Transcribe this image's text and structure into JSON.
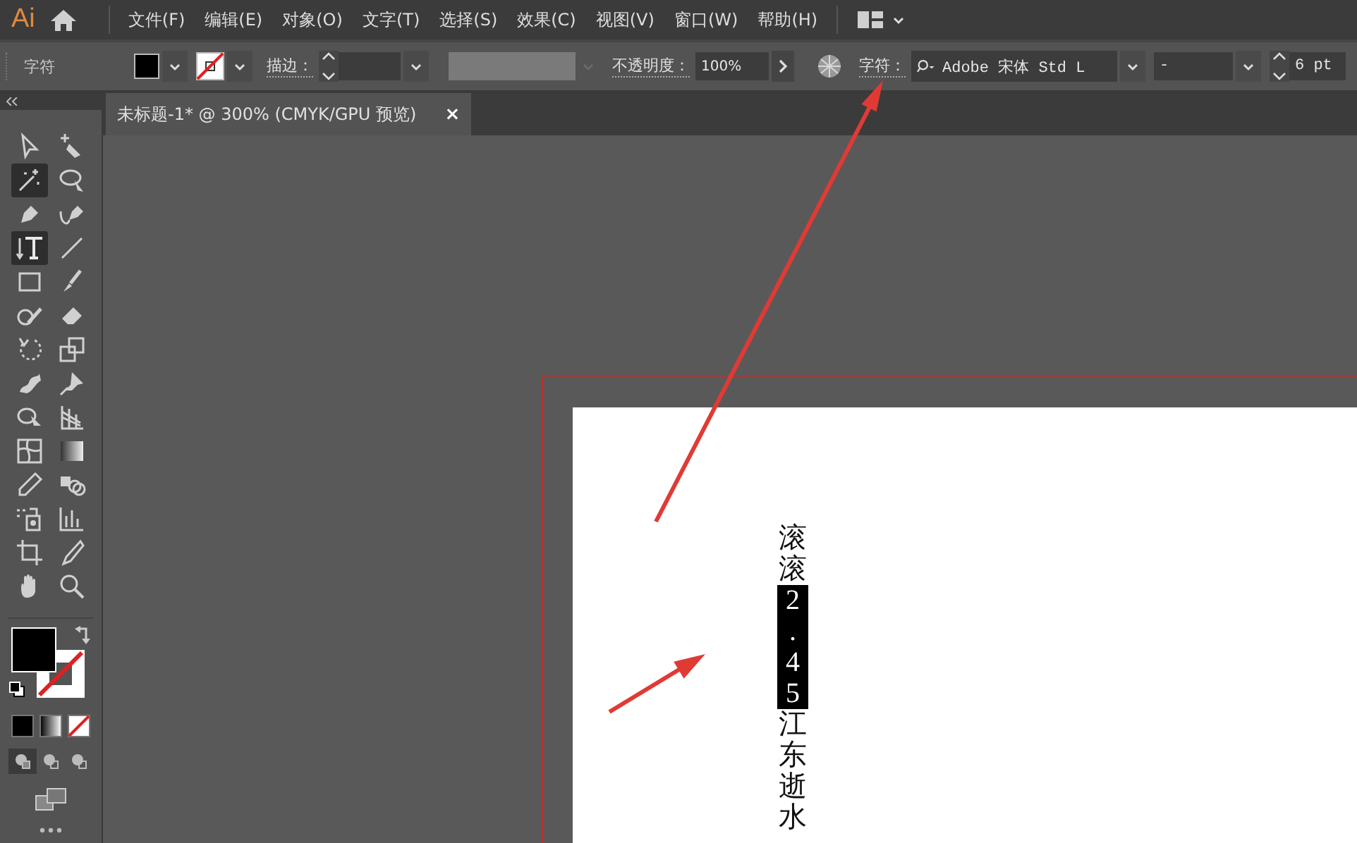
{
  "app": {
    "logo": "Ai"
  },
  "menu": [
    "文件(F)",
    "编辑(E)",
    "对象(O)",
    "文字(T)",
    "选择(S)",
    "效果(C)",
    "视图(V)",
    "窗口(W)",
    "帮助(H)"
  ],
  "control_bar": {
    "panel_label": "字符",
    "stroke_label": "描边：",
    "opacity_label": "不透明度：",
    "opacity": "100%",
    "character_label": "字符：",
    "font": "Adobe 宋体 Std L",
    "font_style": "-",
    "font_size": "6 pt"
  },
  "document_tab": {
    "title": "未标题-1* @ 300% (CMYK/GPU 预览)",
    "close": "×"
  },
  "tools": [
    {
      "selected": false
    },
    {
      "selected": false
    },
    {
      "selected": true
    },
    {
      "selected": false
    },
    {
      "selected": false
    },
    {
      "selected": false
    },
    {
      "selected": true
    },
    {
      "selected": false
    },
    {
      "selected": false
    },
    {
      "selected": false
    },
    {
      "selected": false
    },
    {
      "selected": false
    },
    {
      "selected": false
    },
    {
      "selected": false
    },
    {
      "selected": false
    },
    {
      "selected": false
    },
    {
      "selected": false
    },
    {
      "selected": false
    },
    {
      "selected": false
    },
    {
      "selected": false
    },
    {
      "selected": false
    },
    {
      "selected": false
    },
    {
      "selected": false
    },
    {
      "selected": false
    },
    {
      "selected": false
    },
    {
      "selected": false
    },
    {
      "selected": false
    },
    {
      "selected": false
    }
  ],
  "draw_modes": [
    {
      "selected": true
    },
    {
      "selected": false
    },
    {
      "selected": false
    }
  ],
  "artboard": {
    "vertical_text": [
      {
        "text": "滚滚",
        "selected": false
      },
      {
        "text": "2.45",
        "selected": true
      },
      {
        "text": "江东逝水",
        "selected": false
      }
    ]
  }
}
